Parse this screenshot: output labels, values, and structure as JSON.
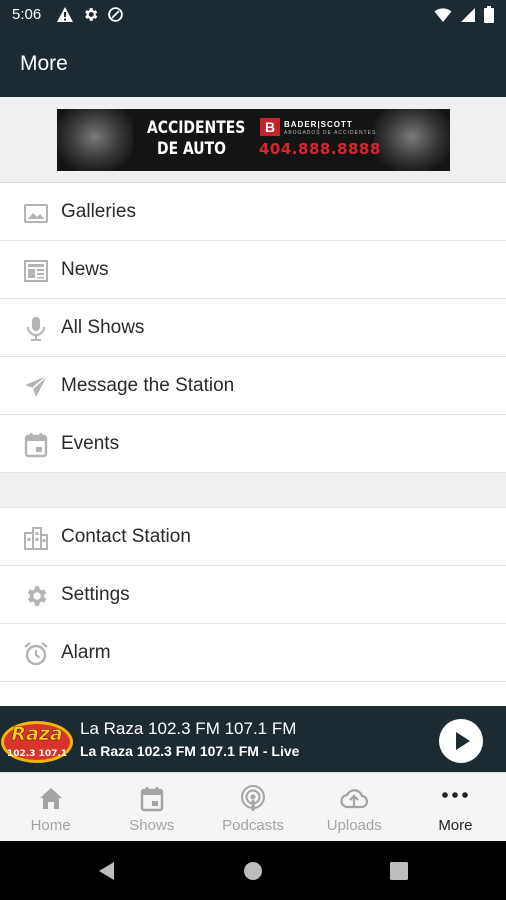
{
  "status_bar": {
    "time": "5:06",
    "left_icons": [
      "alert-icon",
      "gear-icon",
      "data-saver-icon"
    ],
    "right_icons": [
      "wifi-icon",
      "signal-icon",
      "battery-icon"
    ]
  },
  "app_bar": {
    "title": "More"
  },
  "ad": {
    "line1": "ACCIDENTES",
    "line2": "DE AUTO",
    "logo_letter": "B",
    "brand": "BADER|SCOTT",
    "brand_sub": "ABOGADOS DE ACCIDENTES",
    "phone": "404.888.8888"
  },
  "menu": {
    "group1": [
      {
        "label": "Galleries",
        "icon": "image-icon"
      },
      {
        "label": "News",
        "icon": "newspaper-icon"
      },
      {
        "label": "All Shows",
        "icon": "microphone-icon"
      },
      {
        "label": "Message the Station",
        "icon": "send-icon"
      },
      {
        "label": "Events",
        "icon": "calendar-icon"
      }
    ],
    "group2": [
      {
        "label": "Contact Station",
        "icon": "building-icon"
      },
      {
        "label": "Settings",
        "icon": "gear-icon"
      },
      {
        "label": "Alarm",
        "icon": "alarm-icon"
      }
    ]
  },
  "now_playing": {
    "logo_text": "Raza",
    "logo_freq": "102.3 107.1",
    "title": "La Raza 102.3 FM 107.1 FM",
    "subtitle": "La Raza 102.3 FM 107.1 FM - Live"
  },
  "bottom_nav": {
    "items": [
      {
        "label": "Home",
        "icon": "home-icon",
        "active": false
      },
      {
        "label": "Shows",
        "icon": "calendar-icon",
        "active": false
      },
      {
        "label": "Podcasts",
        "icon": "podcast-icon",
        "active": false
      },
      {
        "label": "Uploads",
        "icon": "cloud-upload-icon",
        "active": false
      },
      {
        "label": "More",
        "icon": "more-dots-icon",
        "active": true
      }
    ]
  },
  "colors": {
    "header_bg": "#1c2b31",
    "icon_gray": "#b4b4b4",
    "ad_red": "#d8262d"
  }
}
